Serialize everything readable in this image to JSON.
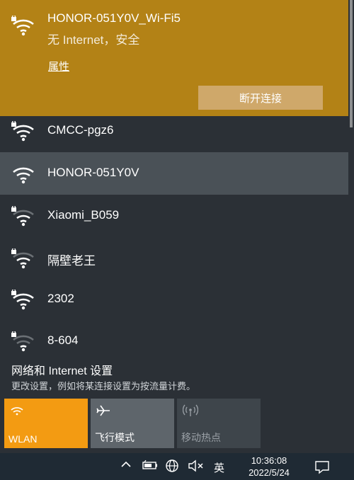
{
  "connected_network": {
    "name": "HONOR-051Y0V_Wi-Fi5",
    "status": "无 Internet，安全",
    "properties_label": "属性",
    "disconnect_label": "断开连接"
  },
  "networks": [
    {
      "name": "CMCC-pgz6",
      "secured": true
    },
    {
      "name": "HONOR-051Y0V",
      "secured": false
    },
    {
      "name": "Xiaomi_B059",
      "secured": true
    },
    {
      "name": "隔壁老王",
      "secured": true
    },
    {
      "name": "2302",
      "secured": true
    },
    {
      "name": "8-604",
      "secured": true
    }
  ],
  "settings": {
    "title": "网络和 Internet 设置",
    "subtitle": "更改设置，例如将某连接设置为按流量计费。"
  },
  "quick_actions": [
    {
      "label": "WLAN",
      "icon": "wifi-icon",
      "state": "on"
    },
    {
      "label": "飞行模式",
      "icon": "airplane-icon",
      "state": "off"
    },
    {
      "label": "移动热点",
      "icon": "hotspot-icon",
      "state": "disabled"
    }
  ],
  "taskbar": {
    "ime_label": "英",
    "time": "10:36:08",
    "date": "2022/5/24"
  },
  "colors": {
    "connected_bg": "#b38216",
    "accent_tile": "#f39b12",
    "flyout_bg": "#2b3036"
  }
}
